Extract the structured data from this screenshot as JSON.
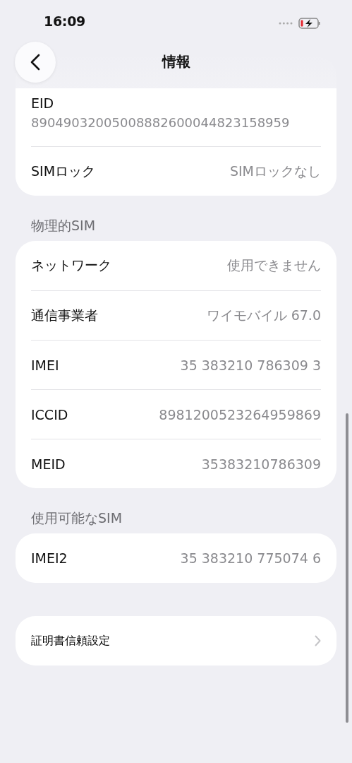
{
  "status_bar": {
    "time": "16:09"
  },
  "header": {
    "title": "情報"
  },
  "sections": [
    {
      "rows": [
        {
          "kind": "stacked",
          "label": "EID",
          "value": "89049032005008882600044823158959"
        },
        {
          "kind": "inline",
          "label": "SIMロック",
          "value": "SIMロックなし"
        }
      ]
    },
    {
      "header": "物理的SIM",
      "rows": [
        {
          "kind": "inline",
          "label": "ネットワーク",
          "value": "使用できません"
        },
        {
          "kind": "inline",
          "label": "通信事業者",
          "value": "ワイモバイル 67.0"
        },
        {
          "kind": "inline",
          "label": "IMEI",
          "value": "35 383210 786309 3"
        },
        {
          "kind": "inline",
          "label": "ICCID",
          "value": "8981200523264959869"
        },
        {
          "kind": "inline",
          "label": "MEID",
          "value": "35383210786309"
        }
      ]
    },
    {
      "header": "使用可能なSIM",
      "rows": [
        {
          "kind": "inline",
          "label": "IMEI2",
          "value": "35 383210 775074 6"
        }
      ]
    },
    {
      "rows": [
        {
          "kind": "link",
          "label": "証明書信頼設定"
        }
      ]
    }
  ]
}
